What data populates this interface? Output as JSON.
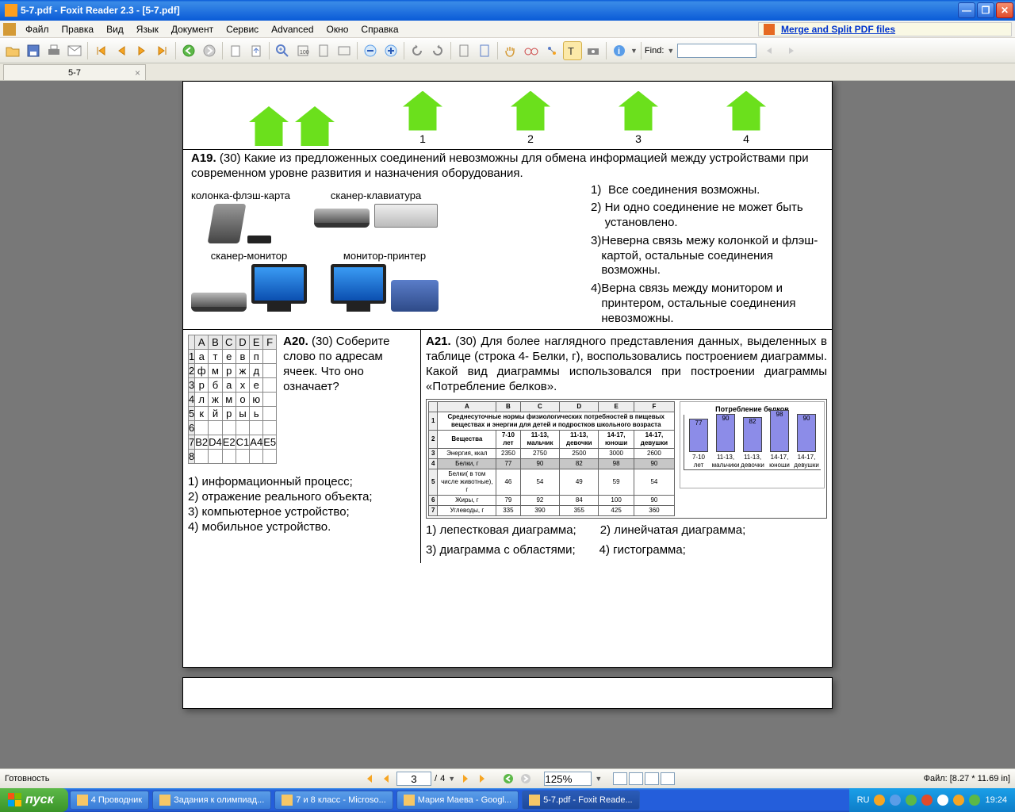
{
  "title": "5-7.pdf - Foxit Reader 2.3 - [5-7.pdf]",
  "menus": [
    "Файл",
    "Правка",
    "Вид",
    "Язык",
    "Документ",
    "Сервис",
    "Advanced",
    "Окно",
    "Справка"
  ],
  "ad": "Merge and Split PDF files",
  "find_label": "Find:",
  "tab_name": "5-7",
  "house_nums": [
    "1",
    "2",
    "3",
    "4"
  ],
  "a19": {
    "head": "А19.",
    "score": "(30)",
    "text": " Какие из предложенных соединений невозможны для обмена информацией между устройствами при современном уровне развития и назначения оборудования.",
    "labels": {
      "kf": "колонка-флэш-карта",
      "sk": "сканер-клавиатура",
      "sm": "сканер-монитор",
      "mp": "монитор-принтер"
    },
    "opts": [
      "Все соединения возможны.",
      "Ни одно соединение не может быть установлено.",
      "Неверна связь межу колонкой и флэш-картой, остальные соединения возможны.",
      "Верна связь между монитором и принтером, остальные соединения невозможны."
    ]
  },
  "a20": {
    "head": "А20.",
    "text": "(30) Соберите слово по адресам ячеек. Что оно означает?",
    "cols": [
      "",
      "A",
      "B",
      "C",
      "D",
      "E",
      "F"
    ],
    "rows": [
      [
        "1",
        "а",
        "т",
        "е",
        "в",
        "п",
        ""
      ],
      [
        "2",
        "ф",
        "м",
        "р",
        "ж",
        "д",
        ""
      ],
      [
        "3",
        "р",
        "б",
        "а",
        "х",
        "е",
        ""
      ],
      [
        "4",
        "л",
        "ж",
        "м",
        "о",
        "ю",
        ""
      ],
      [
        "5",
        "к",
        "й",
        "р",
        "ы",
        "ь",
        ""
      ],
      [
        "6",
        "",
        "",
        "",
        "",
        "",
        ""
      ],
      [
        "7",
        "B2",
        "D4",
        "E2",
        "C1",
        "A4",
        "E5"
      ],
      [
        "8",
        "",
        "",
        "",
        "",
        "",
        ""
      ]
    ],
    "opts": [
      "1) информационный процесс;",
      "2) отражение реального объекта;",
      "3) компьютерное устройство;",
      "4) мобильное устройство."
    ]
  },
  "a21": {
    "head": "А21.",
    "score": "(30)",
    "text": " Для более наглядного представления данных, выделенных в таблице (строка 4- Белки, г), воспользовались построением диаграммы. Какой вид диаграммы использовался при построении диаграммы «Потребление белков».",
    "tbl_title": "Среднесуточные нормы физиологических потребностей в пищевых веществах и энергии для детей и подростков школьного возраста",
    "tbl_cols": [
      "",
      "A",
      "B",
      "C",
      "D",
      "E",
      "F"
    ],
    "tbl_head": [
      "",
      "Вещества",
      "7-10 лет",
      "11-13, мальчик",
      "11-13, девочки",
      "14-17, юноши",
      "14-17, девушки"
    ],
    "tbl_rows": [
      [
        "3",
        "Энергия, ккал",
        "2350",
        "2750",
        "2500",
        "3000",
        "2600"
      ],
      [
        "4",
        "Белки, г",
        "77",
        "90",
        "82",
        "98",
        "90"
      ],
      [
        "5",
        "Белки( в том числе животные), г",
        "46",
        "54",
        "49",
        "59",
        "54"
      ],
      [
        "6",
        "Жиры, г",
        "79",
        "92",
        "84",
        "100",
        "90"
      ],
      [
        "7",
        "Углеводы, г",
        "335",
        "390",
        "355",
        "425",
        "360"
      ]
    ],
    "chart_title": "Потребление белков",
    "opts": [
      "1) лепестковая диаграмма;",
      "2) линейчатая диаграмма;",
      "3) диаграмма с областями;",
      "4) гистограмма;"
    ]
  },
  "chart_data": {
    "type": "bar",
    "title": "Потребление белков",
    "categories": [
      "7-10 лет",
      "11-13, мальчики",
      "11-13, девочки",
      "14-17, юноши",
      "14-17, девушки"
    ],
    "values": [
      77,
      90,
      82,
      98,
      90
    ],
    "ylim": [
      0,
      120
    ]
  },
  "status": "Готовность",
  "page_nav": {
    "current": "3",
    "total": "4",
    "zoom": "125%"
  },
  "file_info": "Файл: [8.27 * 11.69 in]",
  "start": "пуск",
  "task_items": [
    "4 Проводник",
    "Задания к олимпиад...",
    "7 и 8  класс - Microso...",
    "Мария Маева - Googl...",
    "5-7.pdf - Foxit Reade..."
  ],
  "lang": "RU",
  "clock": "19:24"
}
